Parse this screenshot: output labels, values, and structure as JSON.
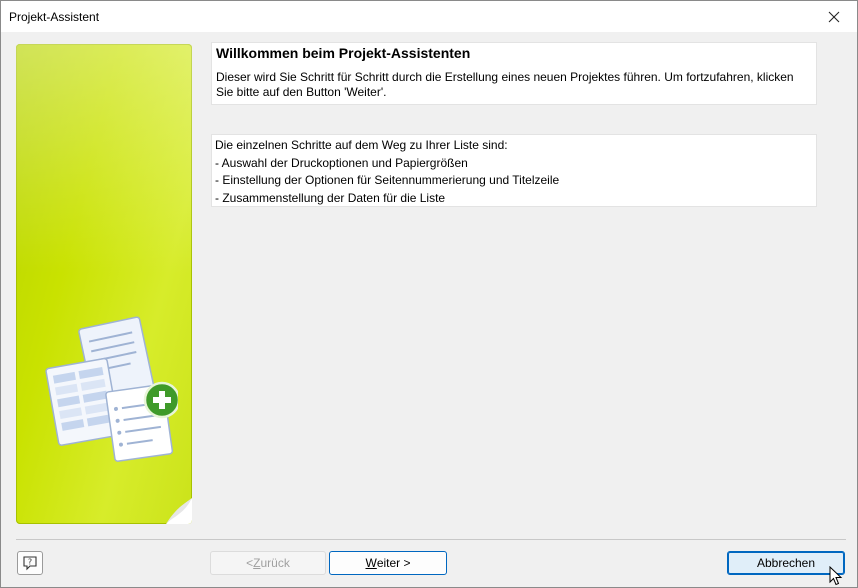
{
  "window": {
    "title": "Projekt-Assistent"
  },
  "welcome": {
    "heading": "Willkommen beim Projekt-Assistenten",
    "text": "Dieser wird Sie Schritt für Schritt durch die Erstellung eines neuen Projektes führen. Um fortzufahren, klicken Sie bitte auf den Button 'Weiter'."
  },
  "steps": {
    "intro": "Die einzelnen Schritte auf dem Weg zu Ihrer Liste sind:",
    "items": [
      "- Auswahl der Druckoptionen und Papiergrößen",
      "- Einstellung der Optionen für Seitennummerierung und Titelzeile",
      "- Zusammenstellung der Daten für die Liste"
    ]
  },
  "buttons": {
    "back": {
      "prefix": "< ",
      "accel": "Z",
      "rest": "urück",
      "enabled": false
    },
    "next": {
      "accel": "W",
      "rest": "eiter >"
    },
    "cancel": {
      "label": "Abbrechen"
    },
    "help_icon": "help-question-icon"
  },
  "colors": {
    "panel_green": "#c9e200",
    "focus_blue": "#0067c0",
    "disabled_text": "#a0a0a0"
  }
}
